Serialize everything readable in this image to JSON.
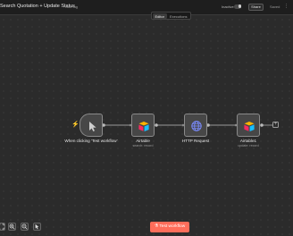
{
  "header": {
    "workflow_title": "Search Quotation + Update Status",
    "add_tag_label": "+ Add tag",
    "inactive_label": "Inactive",
    "share_label": "Share",
    "saved_label": "Saved",
    "more_icon": "more-vert-icon"
  },
  "tabs": [
    {
      "label": "Editor",
      "active": true
    },
    {
      "label": "Executions",
      "active": false
    }
  ],
  "nodes": [
    {
      "label": "When clicking ‘Test workflow’",
      "subtitle": "",
      "icon": "cursor-icon"
    },
    {
      "label": "Airtable",
      "subtitle": "search: record",
      "icon": "airtable-icon"
    },
    {
      "label": "HTTP Request",
      "subtitle": "",
      "icon": "globe-icon"
    },
    {
      "label": "Airtable1",
      "subtitle": "update: record",
      "icon": "airtable-icon"
    }
  ],
  "canvas_controls": {
    "buttons": [
      "fit-view-icon",
      "zoom-in-icon",
      "zoom-out-icon",
      "reset-zoom-icon"
    ]
  },
  "test_button": {
    "label": "Test workflow",
    "icon": "flask-icon"
  },
  "colors": {
    "accent": "#ff6d5a",
    "canvas_bg": "#2b2b2b",
    "node_bg": "#474747",
    "node_border": "#8a8a8a",
    "http_icon": "#7b8cff"
  }
}
